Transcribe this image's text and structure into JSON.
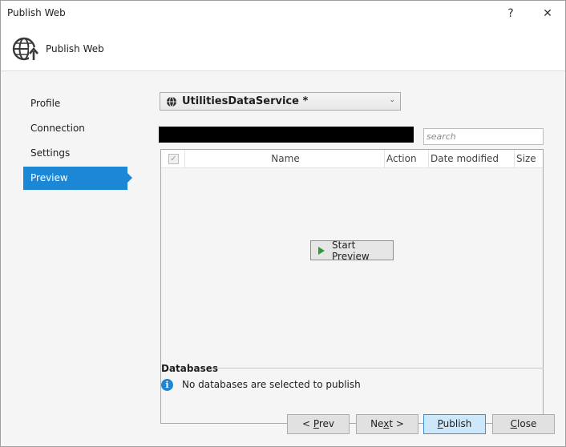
{
  "window": {
    "title": "Publish Web",
    "help_glyph": "?",
    "close_glyph": "✕"
  },
  "header": {
    "title": "Publish Web",
    "icon": "globe-publish-icon"
  },
  "nav": {
    "items": [
      {
        "label": "Profile",
        "active": false
      },
      {
        "label": "Connection",
        "active": false
      },
      {
        "label": "Settings",
        "active": false
      },
      {
        "label": "Preview",
        "active": true
      }
    ]
  },
  "profile": {
    "selected": "UtilitiesDataService *",
    "icon": "globe-icon"
  },
  "search": {
    "placeholder": "search",
    "value": ""
  },
  "grid": {
    "columns": [
      "Name",
      "Action",
      "Date modified",
      "Size"
    ],
    "select_all_checked": true,
    "start_preview_label": "Start Preview"
  },
  "databases": {
    "heading": "Databases",
    "message": "No databases are selected to publish"
  },
  "buttons": {
    "prev": {
      "prefix": "< ",
      "accel": "P",
      "rest": "rev"
    },
    "next": {
      "prefix": "Ne",
      "accel": "x",
      "rest": "t >"
    },
    "publish": {
      "prefix": "",
      "accel": "P",
      "rest": "ublish"
    },
    "close": {
      "prefix": "",
      "accel": "C",
      "rest": "lose"
    }
  },
  "colors": {
    "accent": "#1c87d5",
    "play_green": "#2d9a3a",
    "publish_bg": "#cde8fb"
  }
}
